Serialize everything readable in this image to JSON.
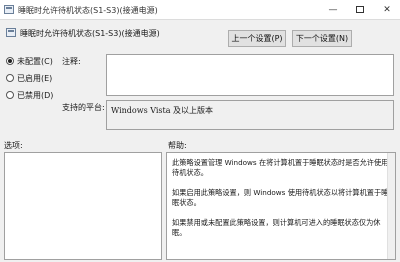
{
  "window": {
    "title": "睡眠时允许待机状态(S1-S3)(接通电源)",
    "minimize_glyph": "—",
    "close_glyph": "✕"
  },
  "header": {
    "policy_name": "睡眠时允许待机状态(S1-S3)(接通电源)",
    "prev_button": "上一个设置(P)",
    "next_button": "下一个设置(N)"
  },
  "state": {
    "options": [
      {
        "label": "未配置(C)",
        "checked": true
      },
      {
        "label": "已启用(E)",
        "checked": false
      },
      {
        "label": "已禁用(D)",
        "checked": false
      }
    ]
  },
  "comment": {
    "label": "注释:",
    "value": ""
  },
  "platform": {
    "label": "支持的平台:",
    "value": "Windows Vista 及以上版本"
  },
  "options_panel": {
    "label": "选项:"
  },
  "help_panel": {
    "label": "帮助:",
    "paragraphs": [
      "此策略设置管理 Windows 在将计算机置于睡眠状态时是否允许使用待机状态。",
      "如果启用此策略设置，则 Windows 使用待机状态以将计算机置于睡眠状态。",
      "如果禁用或未配置此策略设置，则计算机可进入的睡眠状态仅为休眠。"
    ]
  }
}
